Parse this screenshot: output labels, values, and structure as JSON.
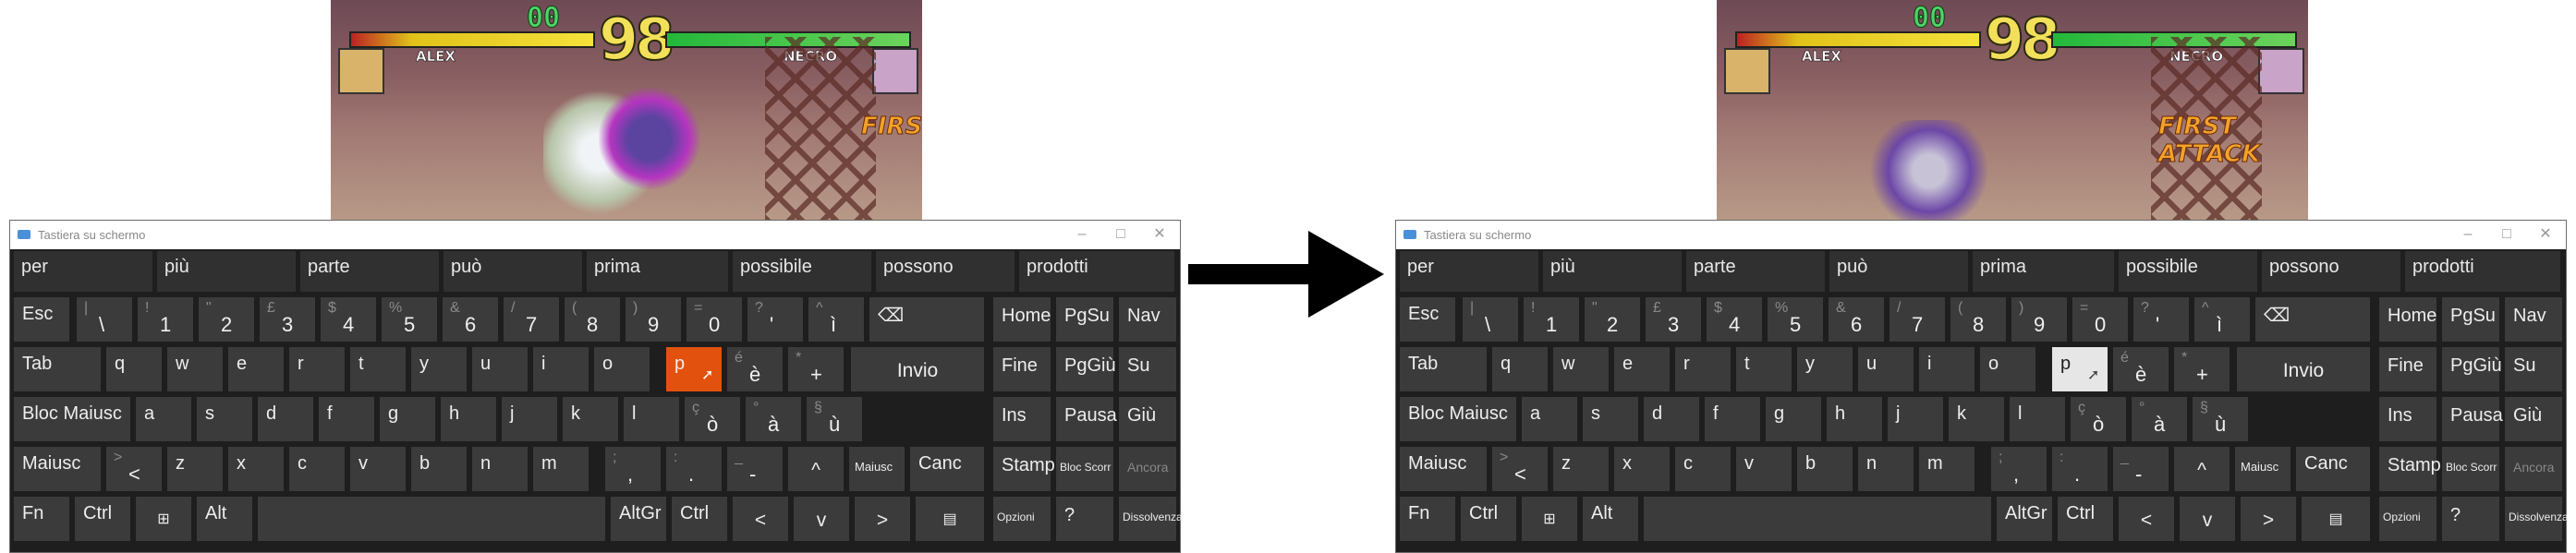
{
  "panels": [
    {
      "id": "before",
      "game": {
        "score": "00",
        "timer": "98",
        "p1": "ALEX",
        "p2": "NECRO",
        "banner": "FIRST"
      },
      "osk_title": "Tastiera su schermo",
      "highlight": "orange"
    },
    {
      "id": "after",
      "game": {
        "score": "00",
        "timer": "98",
        "p1": "ALEX",
        "p2": "NECRO",
        "banner": "FIRST ATTACK"
      },
      "osk_title": "Tastiera su schermo",
      "highlight": "white"
    }
  ],
  "suggestions": [
    "per",
    "più",
    "parte",
    "può",
    "prima",
    "possibile",
    "possono",
    "prodotti"
  ],
  "keys": {
    "esc": "Esc",
    "backslash": "\\",
    "backslash_top": "|",
    "n1": "1",
    "n1_top": "!",
    "n2": "2",
    "n2_top": "\"",
    "n3": "3",
    "n3_top": "£",
    "n4": "4",
    "n4_top": "$",
    "n5": "5",
    "n5_top": "%",
    "n6": "6",
    "n6_top": "&",
    "n7": "7",
    "n7_top": "/",
    "n8": "8",
    "n8_top": "(",
    "n9": "9",
    "n9_top": ")",
    "n0": "0",
    "n0_top": "=",
    "apos": "'",
    "apos_top": "?",
    "igrave": "ì",
    "igrave_top": "^",
    "backspace": "⌫",
    "home": "Home",
    "pgsu": "PgSu",
    "nav": "Nav",
    "tab": "Tab",
    "q": "q",
    "w": "w",
    "e": "e",
    "r": "r",
    "t": "t",
    "y": "y",
    "u": "u",
    "i": "i",
    "o": "o",
    "p": "p",
    "egrave": "è",
    "egrave_top": "é",
    "plus": "+",
    "plus_top": "*",
    "invio": "Invio",
    "fine": "Fine",
    "pggiu": "PgGiù",
    "su": "Su",
    "caps": "Bloc Maiusc",
    "a": "a",
    "s": "s",
    "d": "d",
    "f": "f",
    "g": "g",
    "h": "h",
    "j": "j",
    "k": "k",
    "l": "l",
    "ograve": "ò",
    "ograve_top": "ç",
    "agrave": "à",
    "agrave_top": "°",
    "ugrave": "ù",
    "ugrave_top": "§",
    "ins": "Ins",
    "pausa": "Pausa",
    "giu": "Giù",
    "shift": "Maiusc",
    "lt": "<",
    "lt_top": ">",
    "z": "z",
    "x": "x",
    "c": "c",
    "v": "v",
    "b": "b",
    "n": "n",
    "m": "m",
    "comma": ",",
    "comma_top": ";",
    "period": ".",
    "period_top": ":",
    "minus": "-",
    "minus_top": "_",
    "up": "^",
    "shift_r": "Maiusc",
    "canc": "Canc",
    "stamp": "Stamp",
    "blocscorr": "Bloc Scorr",
    "ancora": "Ancora",
    "fn": "Fn",
    "ctrl": "Ctrl",
    "win": "⊞",
    "alt": "Alt",
    "altgr": "AltGr",
    "ctrl_r": "Ctrl",
    "left": "<",
    "down": "v",
    "right": ">",
    "menu": "▤",
    "opzioni": "Opzioni",
    "help": "?",
    "dissolvenza": "Dissolvenza"
  },
  "colors": {
    "highlight_orange": "#e2520e",
    "highlight_white": "#e6e6e6",
    "key": "#3b3b3b",
    "keyboard_bg": "#1e1e1e"
  }
}
